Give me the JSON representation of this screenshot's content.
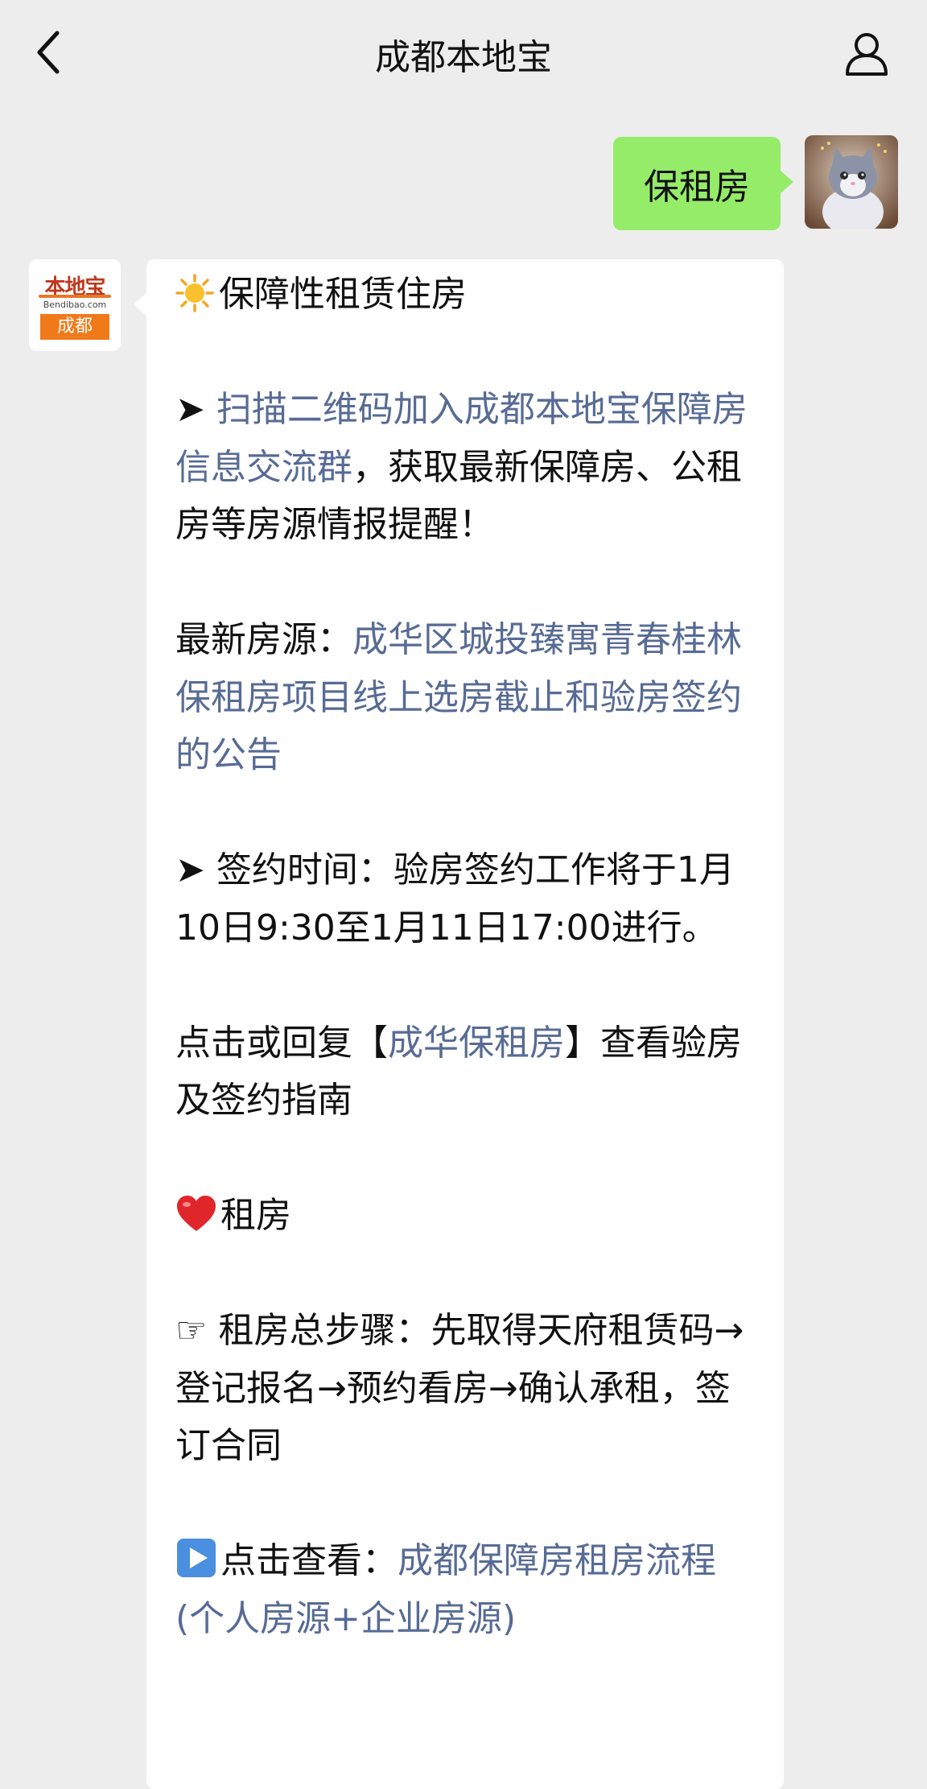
{
  "header": {
    "title": "成都本地宝"
  },
  "sent_message": {
    "text": "保租房"
  },
  "bot": {
    "logo_text": "本地宝",
    "logo_domain": "Bendibao.com",
    "logo_city": "成都"
  },
  "reply": {
    "section1_title": "保障性租赁住房",
    "arrow": "➤",
    "join_link": "扫描二维码加入成都本地宝保障房信息交流群",
    "join_rest": "，获取最新保障房、公租房等房源情报提醒！",
    "latest_label": "最新房源：",
    "latest_link": "成华区城投臻寓青春桂林保租房项目线上选房截止和验房签约的公告",
    "sign_time": "签约时间：验房签约工作将于1月10日9:30至1月11日17:00进行。",
    "tap_prefix": "点击或回复【",
    "tap_link": "成华保租房",
    "tap_suffix": "】查看验房及签约指南",
    "section2_title": "租房",
    "pointer": "☞",
    "steps": "租房总步骤：先取得天府租赁码→登记报名→预约看房→确认承租，签订合同",
    "view_prefix": "点击查看：",
    "view_link": "成都保障房租房流程(个人房源+企业房源)"
  },
  "colors": {
    "background": "#ededed",
    "sent_bubble": "#95ec69",
    "link": "#576b95"
  },
  "icons": [
    "chevron-left-icon",
    "user-profile-icon",
    "sun-emoji-icon",
    "heart-emoji-icon",
    "play-button-emoji-icon"
  ]
}
